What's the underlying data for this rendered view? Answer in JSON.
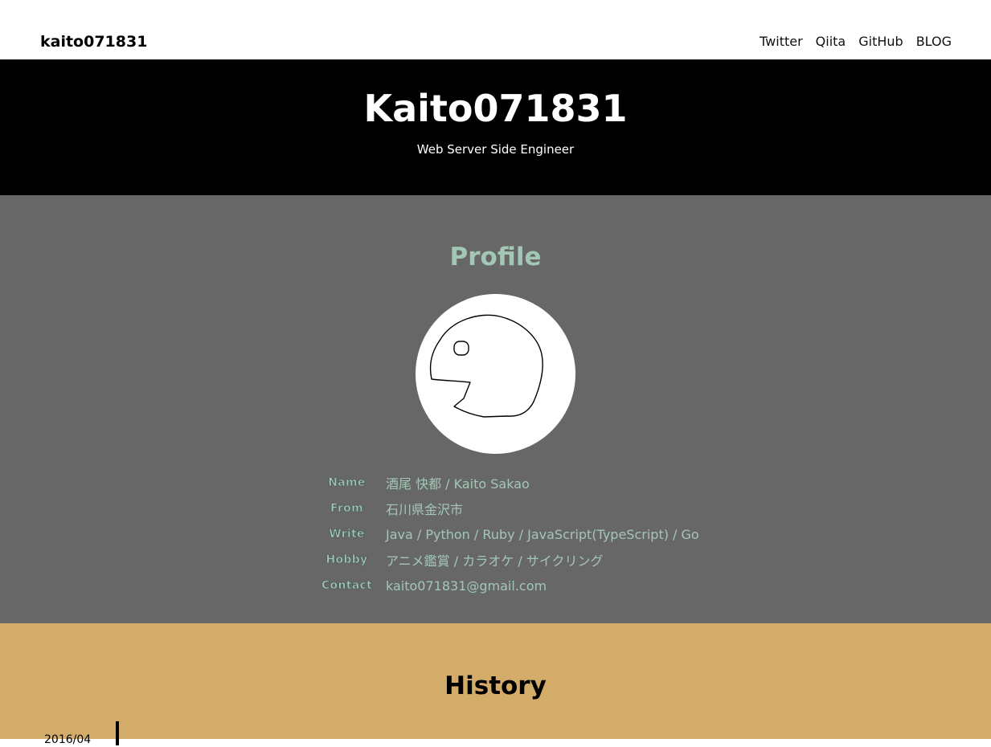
{
  "navbar": {
    "brand": "kaito071831",
    "links": [
      "Twitter",
      "Qiita",
      "GitHub",
      "BLOG"
    ]
  },
  "hero": {
    "title": "Kaito071831",
    "subtitle": "Web Server Side Engineer"
  },
  "profile": {
    "heading": "Profile",
    "avatar_icon": "hand-drawn-creature-icon",
    "rows": [
      {
        "label": "Name",
        "value": "酒尾 快都 / Kaito Sakao"
      },
      {
        "label": "From",
        "value": "石川県金沢市"
      },
      {
        "label": "Write",
        "value": "Java / Python / Ruby / JavaScript(TypeScript) / Go"
      },
      {
        "label": "Hobby",
        "value": "アニメ鑑賞 / カラオケ / サイクリング"
      },
      {
        "label": "Contact",
        "value": "kaito071831@gmail.com"
      }
    ]
  },
  "history": {
    "heading": "History",
    "first_date": "2016/04"
  },
  "colors": {
    "hero_bg": "#000000",
    "profile_bg": "#676767",
    "profile_accent": "#a3c7b6",
    "history_bg": "#d4ac6a"
  }
}
